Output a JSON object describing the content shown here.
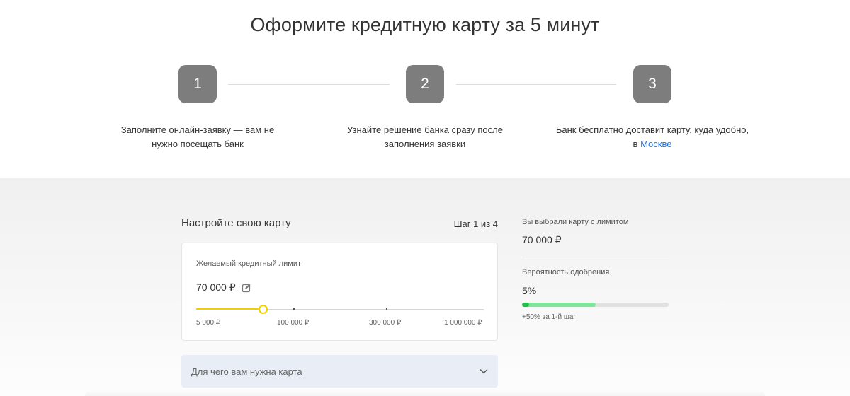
{
  "hero": {
    "title": "Оформите кредитную карту за 5 минут"
  },
  "steps": [
    {
      "number": "1",
      "text": "Заполните онлайн-заявку — вам не нужно посещать банк"
    },
    {
      "number": "2",
      "text": "Узнайте решение банка сразу после заполнения заявки"
    },
    {
      "number": "3",
      "text": "Банк бесплатно доставит карту, куда удобно,",
      "text_prefix": "в",
      "link": "Москве"
    }
  ],
  "configurator": {
    "title": "Настройте свою карту",
    "step_indicator": "Шаг 1 из 4",
    "limit_label": "Желаемый кредитный лимит",
    "limit_value": "70 000 ₽",
    "slider": {
      "current": 70000,
      "marks": [
        "5 000 ₽",
        "100 000 ₽",
        "300 000 ₽",
        "1 000 000 ₽"
      ]
    },
    "purpose_placeholder": "Для чего вам нужна карта"
  },
  "summary": {
    "selected_label": "Вы выбрали карту с лимитом",
    "selected_value": "70 000 ₽",
    "approval_label": "Вероятность одобрения",
    "approval_value": "5%",
    "approval_current": 0.05,
    "approval_potential": 0.5,
    "approval_note": "+50% за 1-й шаг"
  },
  "colors": {
    "accent_yellow": "#f0d000",
    "link_blue": "#1e73e8",
    "progress_green": "#1fbf4b",
    "progress_light_green": "#7ee59a",
    "step_box_gray": "#7d7d7d"
  },
  "icons": {
    "edit": "pencil-edit-icon",
    "dropdown": "chevron-down-icon"
  }
}
